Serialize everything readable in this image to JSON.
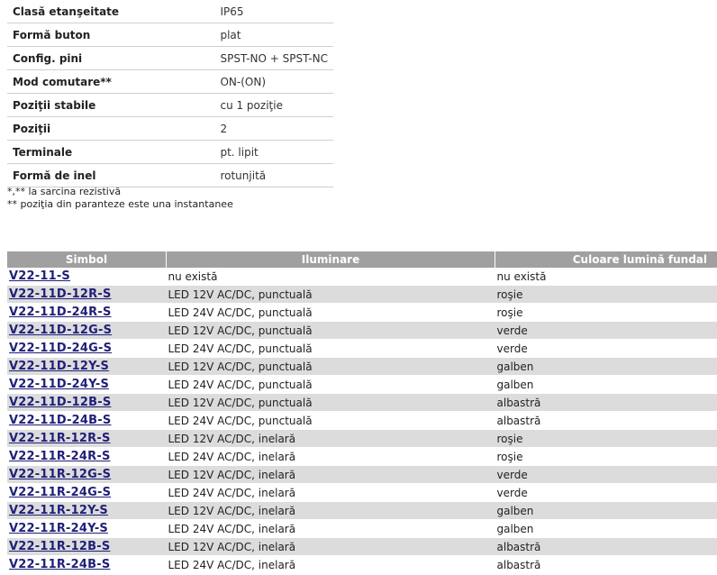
{
  "specs": [
    {
      "label": "Clasă etanşeitate",
      "value": "IP65"
    },
    {
      "label": "Formă buton",
      "value": "plat"
    },
    {
      "label": "Config. pini",
      "value": "SPST-NO + SPST-NC"
    },
    {
      "label": "Mod comutare**",
      "value": "ON-(ON)"
    },
    {
      "label": "Poziţii stabile",
      "value": "cu 1 poziţie"
    },
    {
      "label": "Poziţii",
      "value": "2"
    },
    {
      "label": "Terminale",
      "value": "pt. lipit"
    },
    {
      "label": "Formă de inel",
      "value": "rotunjită"
    }
  ],
  "notes": [
    "*,** la sarcina rezistivă",
    "** poziţia din paranteze este una instantanee"
  ],
  "variants": {
    "headers": [
      "Simbol",
      "Iluminare",
      "Culoare lumină fundal"
    ],
    "rows": [
      {
        "symbol": "V22-11-S",
        "light": "nu există",
        "color": "nu există"
      },
      {
        "symbol": "V22-11D-12R-S",
        "light": "LED 12V AC/DC, punctuală",
        "color": "roşie"
      },
      {
        "symbol": "V22-11D-24R-S",
        "light": "LED 24V AC/DC, punctuală",
        "color": "roşie"
      },
      {
        "symbol": "V22-11D-12G-S",
        "light": "LED 12V AC/DC, punctuală",
        "color": "verde"
      },
      {
        "symbol": "V22-11D-24G-S",
        "light": "LED 24V AC/DC, punctuală",
        "color": "verde"
      },
      {
        "symbol": "V22-11D-12Y-S",
        "light": "LED 12V AC/DC, punctuală",
        "color": "galben"
      },
      {
        "symbol": "V22-11D-24Y-S",
        "light": "LED 24V AC/DC, punctuală",
        "color": "galben"
      },
      {
        "symbol": "V22-11D-12B-S",
        "light": "LED 12V AC/DC, punctuală",
        "color": "albastră"
      },
      {
        "symbol": "V22-11D-24B-S",
        "light": "LED 24V AC/DC, punctuală",
        "color": "albastră"
      },
      {
        "symbol": "V22-11R-12R-S",
        "light": "LED 12V AC/DC, inelară",
        "color": "roşie"
      },
      {
        "symbol": "V22-11R-24R-S",
        "light": "LED 24V AC/DC, inelară",
        "color": "roşie"
      },
      {
        "symbol": "V22-11R-12G-S",
        "light": "LED 12V AC/DC, inelară",
        "color": "verde"
      },
      {
        "symbol": "V22-11R-24G-S",
        "light": "LED 24V AC/DC, inelară",
        "color": "verde"
      },
      {
        "symbol": "V22-11R-12Y-S",
        "light": "LED 12V AC/DC, inelară",
        "color": "galben"
      },
      {
        "symbol": "V22-11R-24Y-S",
        "light": "LED 24V AC/DC, inelară",
        "color": "galben"
      },
      {
        "symbol": "V22-11R-12B-S",
        "light": "LED 12V AC/DC, inelară",
        "color": "albastră"
      },
      {
        "symbol": "V22-11R-24B-S",
        "light": "LED 24V AC/DC, inelară",
        "color": "albastră"
      }
    ]
  }
}
